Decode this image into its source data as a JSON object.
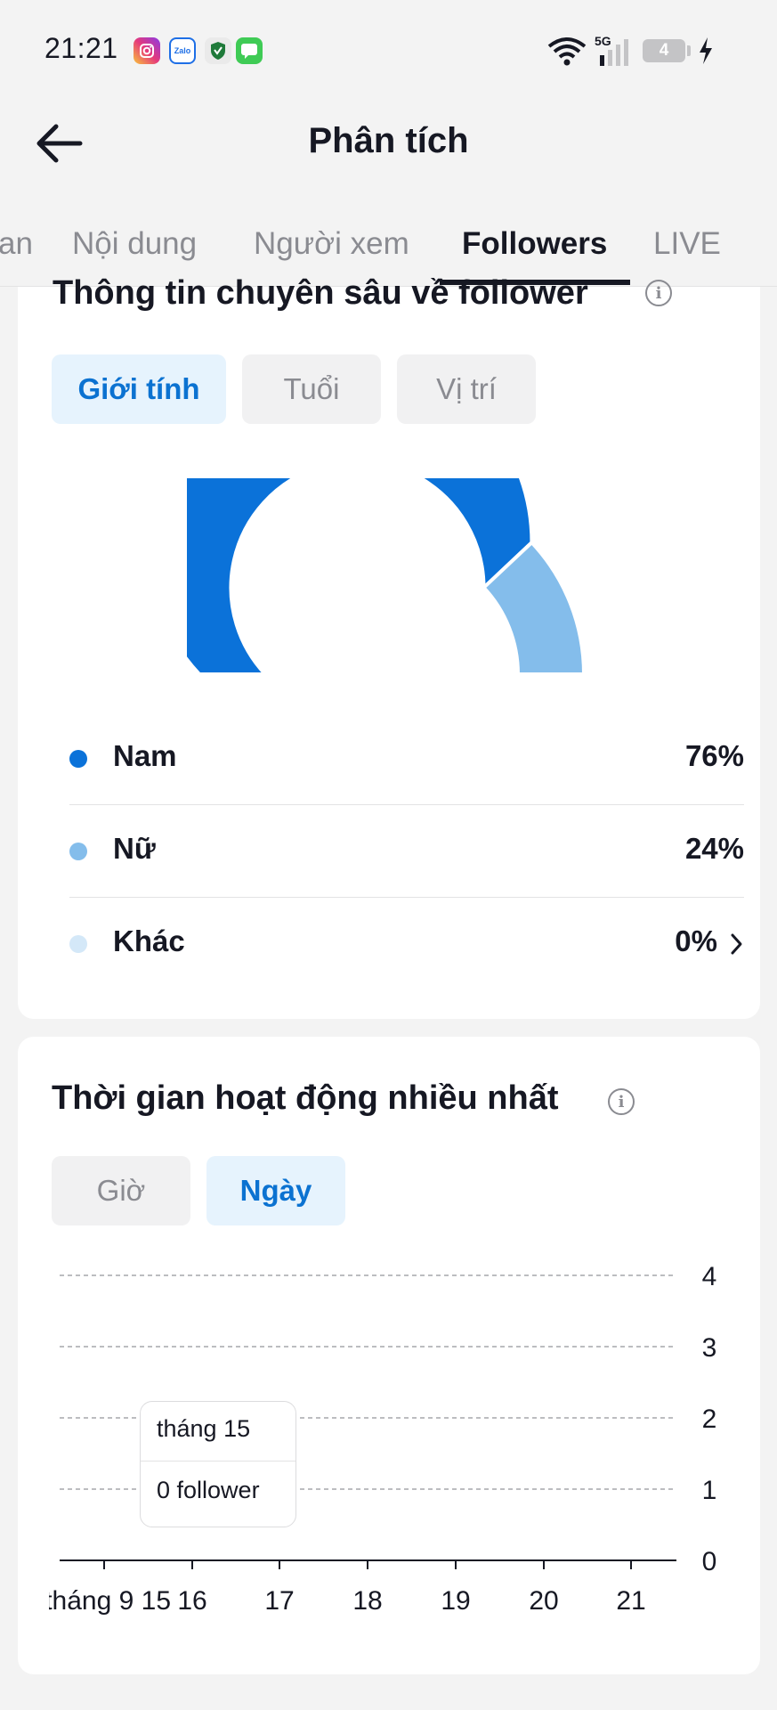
{
  "status_bar": {
    "time": "21:21",
    "network": "5G",
    "battery": "4"
  },
  "header": {
    "title": "Phân tích"
  },
  "tabs": [
    {
      "label": "an",
      "active": false
    },
    {
      "label": "Nội dung",
      "active": false
    },
    {
      "label": "Người xem",
      "active": false
    },
    {
      "label": "Followers",
      "active": true
    },
    {
      "label": "LIVE",
      "active": false
    }
  ],
  "follower_insights": {
    "title": "Thông tin chuyên sâu về follower",
    "filters": [
      {
        "label": "Giới tính",
        "active": true
      },
      {
        "label": "Tuổi",
        "active": false
      },
      {
        "label": "Vị trí",
        "active": false
      }
    ],
    "gender": [
      {
        "label": "Nam",
        "value": "76%",
        "percent": 76,
        "color": "#0b72d9"
      },
      {
        "label": "Nữ",
        "value": "24%",
        "percent": 24,
        "color": "#84bdeb"
      },
      {
        "label": "Khác",
        "value": "0%",
        "percent": 0,
        "color": "#d4e8f8"
      }
    ]
  },
  "most_active": {
    "title": "Thời gian hoạt động nhiều nhất",
    "filters": [
      {
        "label": "Giờ",
        "active": false
      },
      {
        "label": "Ngày",
        "active": true
      }
    ],
    "tooltip": {
      "date": "tháng 15",
      "value": "0 follower"
    }
  },
  "chart_data": {
    "type": "bar",
    "categories": [
      "tháng 9 15",
      "16",
      "17",
      "18",
      "19",
      "20",
      "21"
    ],
    "values": [
      0,
      0,
      0,
      0,
      0,
      0,
      0
    ],
    "y_ticks": [
      0,
      1,
      2,
      3,
      4
    ],
    "ylim": [
      0,
      4
    ],
    "grid": true,
    "y_axis_side": "right"
  }
}
